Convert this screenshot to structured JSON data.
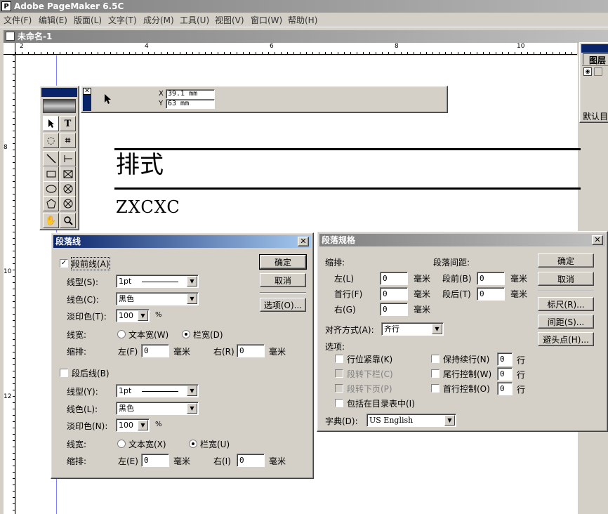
{
  "app": {
    "title": "Adobe PageMaker 6.5C",
    "icon": "P"
  },
  "menu": [
    "文件(F)",
    "编辑(E)",
    "版面(L)",
    "文字(T)",
    "成分(M)",
    "工具(U)",
    "视图(V)",
    "窗口(W)",
    "帮助(H)"
  ],
  "document": {
    "title": "未命名-1",
    "heading": "排式",
    "body_text": "ZXCXC"
  },
  "ruler": {
    "top_labels": [
      "2",
      "4",
      "6",
      "8",
      "10"
    ],
    "left_labels": [
      "8",
      "10",
      "12"
    ]
  },
  "control_palette": {
    "x_label": "X",
    "x_value": "39.1 mm",
    "y_label": "Y",
    "y_value": "63 mm"
  },
  "layers_palette": {
    "tab": "图层",
    "default_label": "默认目"
  },
  "dialog_rule": {
    "title": "段落线",
    "rule_above": {
      "label": "段前线(A)",
      "checked": true,
      "style_label": "线型(S):",
      "style_value": "1pt",
      "color_label": "线色(C):",
      "color_value": "黑色",
      "tint_label": "淡印色(T):",
      "tint_value": "100",
      "tint_unit": "%",
      "width_label": "线宽:",
      "opt_text": "文本宽(W)",
      "opt_column": "栏宽(D)",
      "selected": "column",
      "indent_label": "缩排:",
      "left_label": "左(F)",
      "left_value": "0",
      "right_label": "右(R)",
      "right_value": "0",
      "unit": "毫米"
    },
    "rule_below": {
      "label": "段后线(B)",
      "checked": false,
      "style_label": "线型(Y):",
      "style_value": "1pt",
      "color_label": "线色(L):",
      "color_value": "黑色",
      "tint_label": "淡印色(N):",
      "tint_value": "100",
      "tint_unit": "%",
      "width_label": "线宽:",
      "opt_text": "文本宽(X)",
      "opt_column": "栏宽(U)",
      "selected": "column",
      "indent_label": "缩排:",
      "left_label": "左(E)",
      "left_value": "0",
      "right_label": "右(I)",
      "right_value": "0",
      "unit": "毫米"
    },
    "ok": "确定",
    "cancel": "取消",
    "options": "选项(O)..."
  },
  "dialog_spec": {
    "title": "段落规格",
    "indent_label": "缩排:",
    "spacing_label": "段落间距:",
    "left_label": "左(L)",
    "left_value": "0",
    "first_label": "首行(F)",
    "first_value": "0",
    "right_label": "右(G)",
    "right_value": "0",
    "before_label": "段前(B)",
    "before_value": "0",
    "after_label": "段后(T)",
    "after_value": "0",
    "unit": "毫米",
    "align_label": "对齐方式(A):",
    "align_value": "齐行",
    "options_label": "选项:",
    "opt_keep_lines": "行位紧靠(K)",
    "opt_col_break": "段转下栏(C)",
    "opt_page_break": "段转下页(P)",
    "opt_toc": "包括在目录表中(I)",
    "opt_keep_with": "保持续行(N)",
    "keep_with_value": "0",
    "opt_widow": "尾行控制(W)",
    "widow_value": "0",
    "opt_orphan": "首行控制(O)",
    "orphan_value": "0",
    "line_unit": "行",
    "dict_label": "字典(D):",
    "dict_value": "US English",
    "ok": "确定",
    "cancel": "取消",
    "rules": "标尺(R)...",
    "spacing": "间距(S)...",
    "hyph": "避头点(H)..."
  }
}
